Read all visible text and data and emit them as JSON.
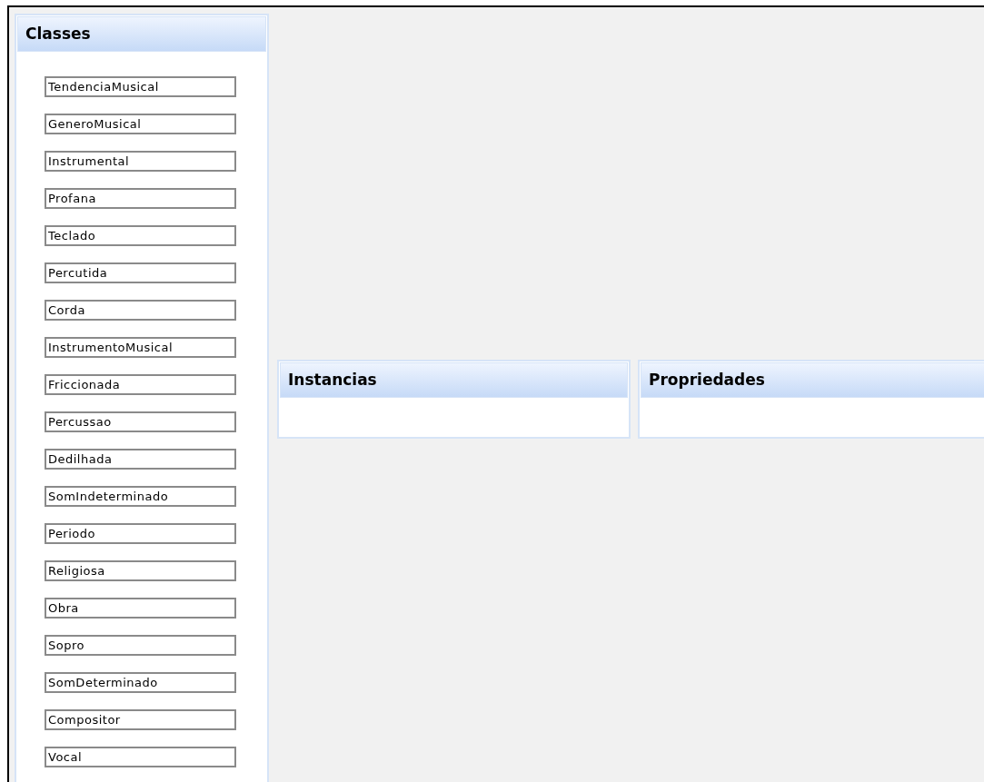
{
  "classes_panel": {
    "title": "Classes",
    "items": [
      {
        "label": "TendenciaMusical"
      },
      {
        "label": "GeneroMusical"
      },
      {
        "label": "Instrumental"
      },
      {
        "label": "Profana"
      },
      {
        "label": "Teclado"
      },
      {
        "label": "Percutida"
      },
      {
        "label": "Corda"
      },
      {
        "label": "InstrumentoMusical"
      },
      {
        "label": "Friccionada"
      },
      {
        "label": "Percussao"
      },
      {
        "label": "Dedilhada"
      },
      {
        "label": "SomIndeterminado"
      },
      {
        "label": "Periodo"
      },
      {
        "label": "Religiosa"
      },
      {
        "label": "Obra"
      },
      {
        "label": "Sopro"
      },
      {
        "label": "SomDeterminado"
      },
      {
        "label": "Compositor"
      },
      {
        "label": "Vocal"
      }
    ]
  },
  "instances_panel": {
    "title": "Instancias"
  },
  "properties_panel": {
    "title": "Propriedades"
  }
}
